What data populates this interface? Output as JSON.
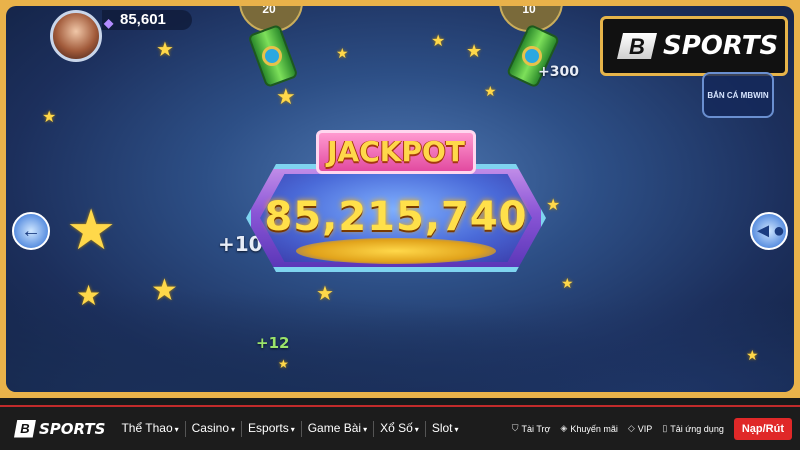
{
  "game": {
    "player_score": "85,601",
    "cannons": [
      {
        "bet": "20"
      },
      {
        "bet": "10"
      }
    ],
    "jackpot": {
      "title": "JACKPOT",
      "value": "85,215,740"
    },
    "floating_points": {
      "top_right": "+300",
      "left": "+10",
      "bottom_left": "+12"
    },
    "badge_text": "BẮN CÁ MBWIN",
    "side_buttons": {
      "left_icon": "arrow-left-icon",
      "right_icon": "fish-icon"
    }
  },
  "brand": {
    "logo_letter": "B",
    "name": "SPORTS"
  },
  "navbar": {
    "logo_letter": "B",
    "logo_text": "SPORTS",
    "menu": [
      {
        "label": "Thể Thao"
      },
      {
        "label": "Casino"
      },
      {
        "label": "Esports"
      },
      {
        "label": "Game Bài"
      },
      {
        "label": "Xổ Số"
      },
      {
        "label": "Slot"
      }
    ],
    "links": [
      {
        "label": "Tài Trợ",
        "icon": "shield-icon"
      },
      {
        "label": "Khuyến mãi",
        "icon": "tag-icon"
      },
      {
        "label": "VIP",
        "icon": "diamond-icon"
      },
      {
        "label": "Tải ứng dụng",
        "icon": "phone-icon"
      }
    ],
    "cta_label": "Nạp/Rút"
  },
  "colors": {
    "accent": "#e02828",
    "frame": "#e9b24a",
    "jackpot_text": "#ffe04a"
  }
}
